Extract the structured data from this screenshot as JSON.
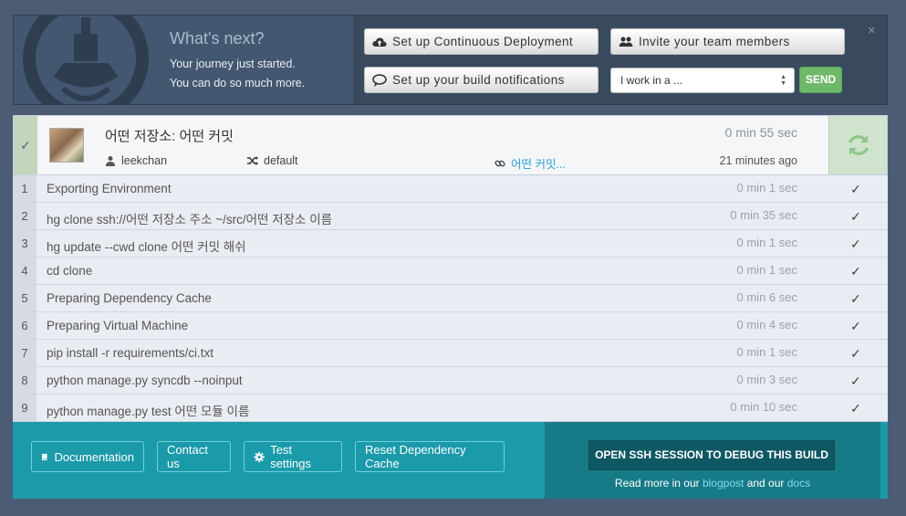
{
  "banner": {
    "title": "What's next?",
    "line1": "Your journey just started.",
    "line2": "You can do so much more.",
    "btn_cd": "Set up Continuous Deployment",
    "btn_invite": "Invite your team members",
    "btn_notify": "Set up your build notifications",
    "select_value": "I work in a ...",
    "send": "SEND",
    "close": "×"
  },
  "build": {
    "title": "어떤 저장소: 어떤 커밋",
    "user": "leekchan",
    "branch": "default",
    "commit": "어떤 커밋...",
    "duration": "0 min 55 sec",
    "ago": "21 minutes ago"
  },
  "steps": [
    {
      "num": "1",
      "cmd": "Exporting Environment",
      "time": "0 min 1 sec"
    },
    {
      "num": "2",
      "cmd": "hg clone ssh://어떤 저장소 주소 ~/src/어떤 저장소 이름",
      "time": "0 min 35 sec"
    },
    {
      "num": "3",
      "cmd": "hg update --cwd clone 어떤 커밋 해쉬",
      "time": "0 min 1 sec"
    },
    {
      "num": "4",
      "cmd": "cd clone",
      "time": "0 min 1 sec"
    },
    {
      "num": "5",
      "cmd": "Preparing Dependency Cache",
      "time": "0 min 6 sec"
    },
    {
      "num": "6",
      "cmd": "Preparing Virtual Machine",
      "time": "0 min 4 sec"
    },
    {
      "num": "7",
      "cmd": "pip install -r requirements/ci.txt",
      "time": "0 min 1 sec"
    },
    {
      "num": "8",
      "cmd": "python manage.py syncdb --noinput",
      "time": "0 min 3 sec"
    },
    {
      "num": "9",
      "cmd": "python manage.py test 어떤 모듈 이름",
      "time": "0 min 10 sec"
    }
  ],
  "footer": {
    "documentation": "Documentation",
    "contact": "Contact us",
    "test_settings": "Test settings",
    "reset_cache": "Reset Dependency Cache",
    "ssh_button": "OPEN SSH SESSION TO DEBUG THIS BUILD",
    "read_more": "Read more in our",
    "blogpost": "blogpost",
    "and_our": "and our",
    "docs": "docs"
  },
  "colors": {
    "accent_green": "#6db967",
    "footer_teal": "#1b9aaa",
    "link_blue": "#2a9fd6"
  }
}
